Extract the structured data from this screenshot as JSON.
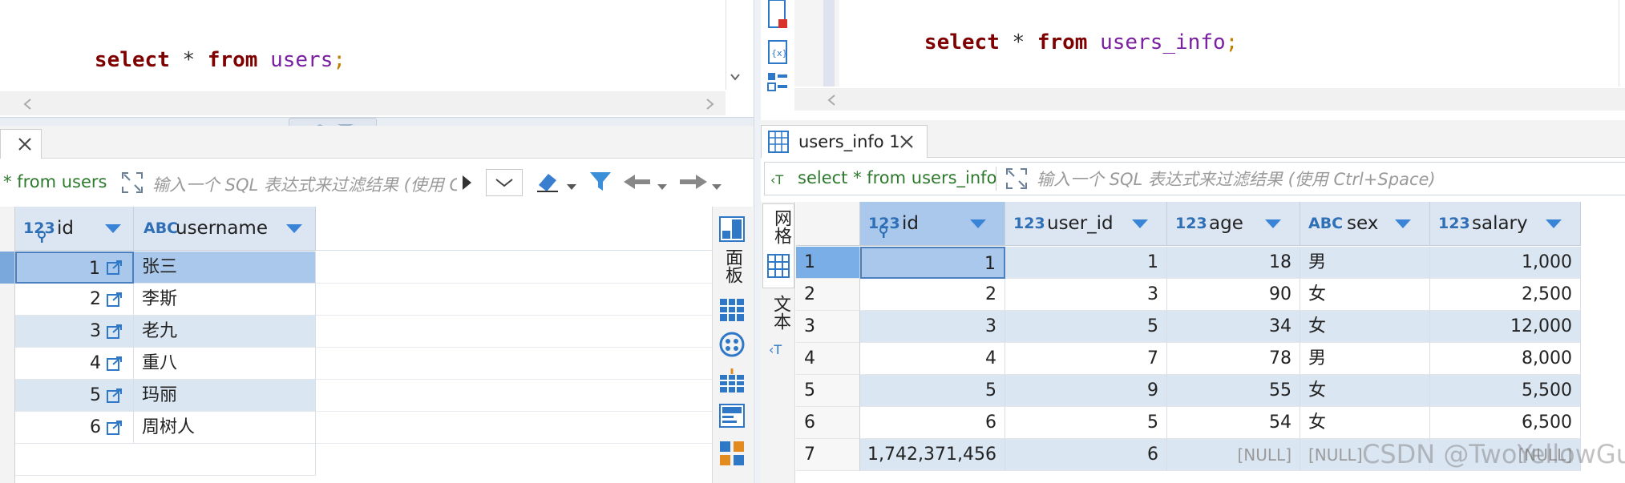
{
  "left": {
    "sql": {
      "kw1": "select",
      "star": "*",
      "kw2": "from",
      "table": "users",
      "end": ";"
    },
    "filter_query": "* from users",
    "filter_placeholder": "输入一个 SQL 表达式来过滤结果 (使用 C",
    "columns": [
      {
        "type": "123",
        "name": "id"
      },
      {
        "type": "ABC",
        "name": "username"
      }
    ],
    "rows": [
      {
        "id": "1",
        "username": "张三"
      },
      {
        "id": "2",
        "username": "李斯"
      },
      {
        "id": "3",
        "username": "老九"
      },
      {
        "id": "4",
        "username": "重八"
      },
      {
        "id": "5",
        "username": "玛丽"
      },
      {
        "id": "6",
        "username": "周树人"
      }
    ],
    "side_tabs": {
      "panel": "面板"
    }
  },
  "right": {
    "sql": {
      "kw1": "select",
      "star": "*",
      "kw2": "from",
      "table": "users_info",
      "end": ";"
    },
    "tab_label": "users_info 1",
    "filter_query": "select * from users_info",
    "filter_placeholder": "输入一个 SQL 表达式来过滤结果 (使用 Ctrl+Space)",
    "view_tabs": {
      "grid": "网格",
      "text": "文本"
    },
    "columns": [
      {
        "type": "123",
        "name": "id"
      },
      {
        "type": "123",
        "name": "user_id"
      },
      {
        "type": "123",
        "name": "age"
      },
      {
        "type": "ABC",
        "name": "sex"
      },
      {
        "type": "123",
        "name": "salary"
      }
    ],
    "rows": [
      {
        "n": "1",
        "id": "1",
        "user_id": "1",
        "age": "18",
        "sex": "男",
        "salary": "1,000"
      },
      {
        "n": "2",
        "id": "2",
        "user_id": "3",
        "age": "90",
        "sex": "女",
        "salary": "2,500"
      },
      {
        "n": "3",
        "id": "3",
        "user_id": "5",
        "age": "34",
        "sex": "女",
        "salary": "12,000"
      },
      {
        "n": "4",
        "id": "4",
        "user_id": "7",
        "age": "78",
        "sex": "男",
        "salary": "8,000"
      },
      {
        "n": "5",
        "id": "5",
        "user_id": "9",
        "age": "55",
        "sex": "女",
        "salary": "5,500"
      },
      {
        "n": "6",
        "id": "6",
        "user_id": "5",
        "age": "54",
        "sex": "女",
        "salary": "6,500"
      },
      {
        "n": "7",
        "id": "1,742,371,456",
        "user_id": "6",
        "age": "[NULL]",
        "sex": "[NULL]",
        "salary": "[NULL]"
      }
    ],
    "watermark": "CSDN @TwoYellowGuns"
  }
}
